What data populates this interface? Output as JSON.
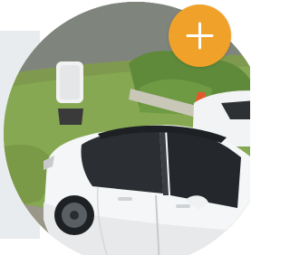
{
  "photo": {
    "subject": "car-on-grass-photo"
  },
  "fab": {
    "icon": "plus-icon",
    "color": "#f0a12a"
  },
  "side_panel": {
    "color": "#e9ecef"
  }
}
